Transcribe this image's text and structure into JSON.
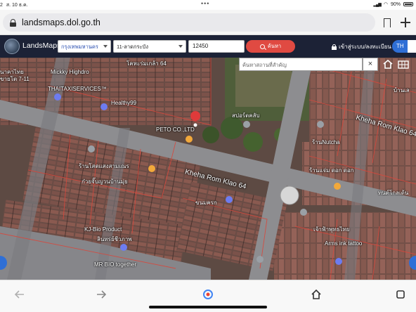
{
  "status_bar": {
    "time": "2",
    "date": "ส. 10 ธ.ค.",
    "battery": "90%"
  },
  "browser": {
    "url": "landsmaps.dol.go.th",
    "icons": [
      "lock-icon",
      "bookmark-icon",
      "plus-icon"
    ]
  },
  "app_header": {
    "brand": "LandsMaps",
    "province": "กรุงเทพมหานคร",
    "district": "11-ลาดกระบัง",
    "postal_code": "12450",
    "search_button": "ค้นหา",
    "login_label": "เข้าสู่ระบบ/ลงทะเบียน",
    "lang_active": "TH",
    "lang_alt": "EN"
  },
  "map": {
    "search_placeholder": "ค้นหาสถานที่สำคัญ",
    "clear_label": "×",
    "labels": {
      "top_left_1": "นาคาไทย",
      "top_left_2": "ขายโต 7-11",
      "mickey": "Mickky Highdro",
      "taxi": "THAITAXISERVICES™",
      "healthy": "Healthy99",
      "peto": "PETO CO.,LTD",
      "sports": "สปอร์ตคลับ",
      "top_right": "บ้านเล",
      "kheha_right": "Kheha Rom Klao 64",
      "nutcha": "ร้านNutcha",
      "road_64_top": "โคหะร่มเกล้า 64",
      "shop_left": "ร้านโสดแสงสามเณร",
      "noodle": "ก๋วยจั๊บญวนบ้านมุ่ย",
      "kheha_main": "Kheha Rom Klao 64",
      "sahadee": "ร้านแจ่ม ดอก ดอก",
      "dentist": "ทนต์โกลเด้น",
      "kj_bio": "KJ-Bio Product",
      "bio_thai": "ลินทรย์ชีวภาพ",
      "tattoo_thai": "เจ้าฟ้าพุทธไทย",
      "arms_ink": "Arms ink tattoo",
      "mr_bio": "MR BIO together",
      "kanom": "ขนมครก"
    }
  },
  "bottom_nav": {
    "icons": [
      "back-icon",
      "forward-icon",
      "assistant-icon",
      "home-icon",
      "tabs-icon"
    ]
  },
  "colors": {
    "header_bg": "#1c2236",
    "search_btn": "#e04a42",
    "lang_active": "#2f6fd6",
    "parcel_line": "#d9473c"
  }
}
